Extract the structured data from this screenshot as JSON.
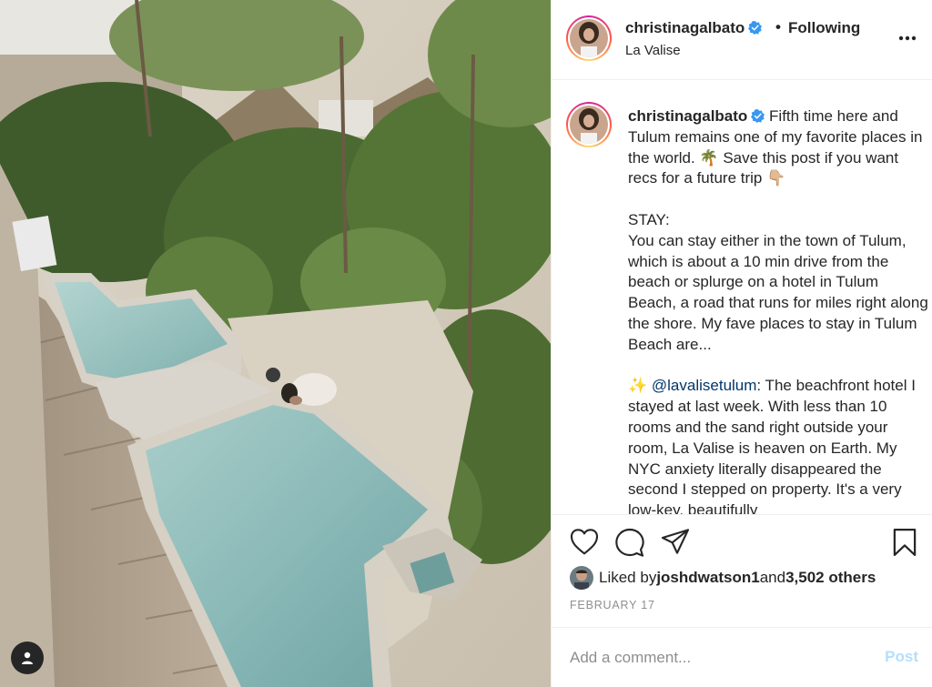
{
  "post": {
    "username": "christinagalbato",
    "following_label": "Following",
    "location": "La Valise"
  },
  "caption": {
    "username": "christinagalbato",
    "text_1": " Fifth time here and Tulum remains one of my favorite places in the world. 🌴 Save this post if you want recs for a future trip 👇🏼\n\nSTAY:\nYou can stay either in the town of Tulum, which is about a 10 min drive from the beach or splurge on a hotel in Tulum Beach, a road that runs for miles right along the shore. My fave places to stay in Tulum Beach are...\n\n✨ ",
    "mention": "@lavalisetulum",
    "text_2": ": The beachfront hotel I stayed at last week. With less than 10 rooms and the sand right outside your room, La Valise is heaven on Earth. My NYC anxiety literally disappeared the second I stepped on property. It's a very low-key, beautifully"
  },
  "likes": {
    "prefix": "Liked by ",
    "user": "joshdwatson1",
    "middle": " and ",
    "others": "3,502 others"
  },
  "date": "FEBRUARY 17",
  "comment_box": {
    "placeholder": "Add a comment...",
    "post_label": "Post"
  },
  "icons": {
    "verified": "verified-badge-icon",
    "more": "more-options-icon",
    "like": "heart-icon",
    "comment": "comment-bubble-icon",
    "share": "paper-plane-icon",
    "save": "bookmark-icon",
    "tags": "user-tag-icon"
  },
  "colors": {
    "verified": "#3897f0",
    "mention": "#00376b",
    "post_disabled": "#b2dffc",
    "muted": "#8e8e8e"
  }
}
